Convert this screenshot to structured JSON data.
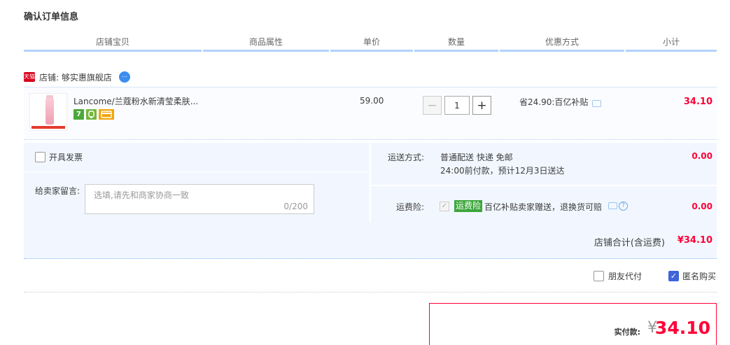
{
  "page": {
    "title": "确认订单信息"
  },
  "table_header": [
    "店铺宝贝",
    "商品属性",
    "单价",
    "数量",
    "优惠方式",
    "小计"
  ],
  "shop": {
    "badge": "天猫",
    "name": "店铺: 够实惠旗舰店"
  },
  "item": {
    "title": "Lancome/兰蔻粉水新清莹柔肤...",
    "badges": [
      "7",
      "",
      ""
    ],
    "price": "59.00",
    "quantity": "1",
    "promotion": "省24.90:百亿补贴",
    "subtotal": "34.10"
  },
  "invoice": {
    "label": "开具发票"
  },
  "memo": {
    "label": "给卖家留言:",
    "placeholder": "选填,请先和商家协商一致",
    "counter": "0/200"
  },
  "shipping": {
    "label": "运送方式:",
    "line1": "普通配送 快递 免邮",
    "line2": "24:00前付款，预计12月3日送达",
    "fee": "0.00"
  },
  "insurance": {
    "label": "运费险:",
    "tag": "运费险",
    "text": "百亿补贴卖家赠送，退换货可赔",
    "fee": "0.00"
  },
  "shop_total": {
    "label": "店铺合计(含运费)",
    "amount": "¥34.10"
  },
  "options": {
    "friend_pay": "朋友代付",
    "anonymous": "匿名购买"
  },
  "payment": {
    "label": "实付款:",
    "currency": "¥",
    "amount": "34.10"
  },
  "colors": {
    "accent_red": "#ff0036",
    "header_line": "#b2d1ff",
    "panel_bg": "#f2f7ff"
  }
}
